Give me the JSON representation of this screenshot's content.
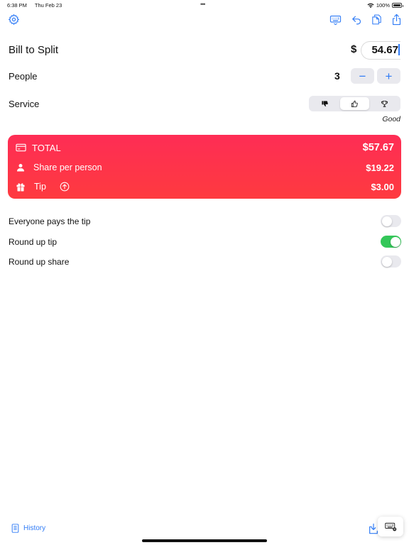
{
  "status_bar": {
    "time": "6:38 PM",
    "date": "Thu Feb 23",
    "battery": "100%",
    "dots": "•••"
  },
  "toolbar": {
    "icons": [
      "gear-icon",
      "keyboard-icon",
      "undo-icon",
      "copy-icon",
      "share-icon"
    ],
    "accent": "#2f7bf6"
  },
  "bill": {
    "label": "Bill to Split",
    "currency": "$",
    "amount": "54.67"
  },
  "people": {
    "label": "People",
    "count": "3",
    "decrement": "−",
    "increment": "+"
  },
  "service": {
    "label": "Service",
    "options": [
      "thumbs-down-icon",
      "thumbs-up-icon",
      "trophy-icon"
    ],
    "selected_index": 1,
    "rating": "Good"
  },
  "summary": {
    "total_label": "TOTAL",
    "total_value": "$57.67",
    "share_label": "Share per person",
    "share_value": "$19.22",
    "tip_label": "Tip",
    "tip_value": "$3.00",
    "gradient_top": "#fe2d55",
    "gradient_bottom": "#fe3a3f"
  },
  "toggles": [
    {
      "label": "Everyone pays the tip",
      "on": false
    },
    {
      "label": "Round up tip",
      "on": true
    },
    {
      "label": "Round up share",
      "on": false
    }
  ],
  "bottom_bar": {
    "history_label": "History",
    "icons": [
      "book-icon",
      "import-icon",
      "keyboard-hide-icon"
    ]
  }
}
